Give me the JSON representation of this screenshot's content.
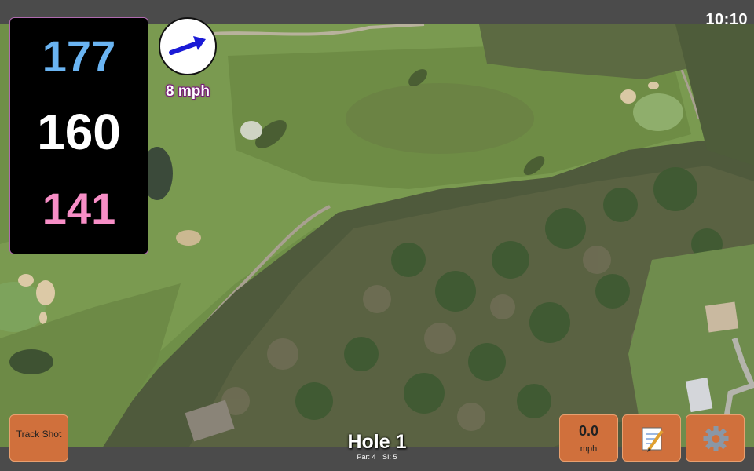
{
  "status": {
    "time": "10:10"
  },
  "distances": {
    "back": "177",
    "middle": "160",
    "front": "141"
  },
  "wind": {
    "speed_label": "8 mph",
    "arrow_icon": "wind-arrow-icon"
  },
  "buttons": {
    "track_shot": "Track Shot",
    "speed_value": "0.0",
    "speed_unit": "mph",
    "notes_icon": "notepad-icon",
    "settings_icon": "gear-icon"
  },
  "hole": {
    "title": "Hole 1",
    "par": "Par: 4",
    "stroke_index": "SI: 5"
  },
  "colors": {
    "back": "#6ab4f2",
    "middle": "#ffffff",
    "front": "#f78ec6",
    "button": "#d0703c",
    "accent": "#b06ab0",
    "bar": "#4b4b4b"
  }
}
